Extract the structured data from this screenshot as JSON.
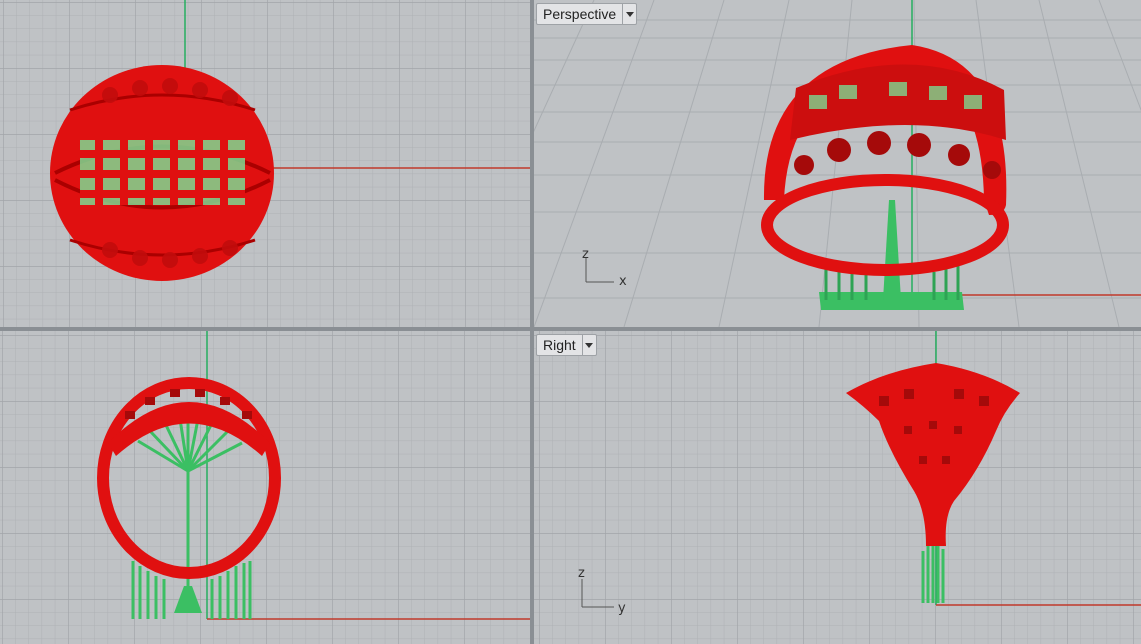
{
  "viewports": {
    "top": {
      "name": ""
    },
    "perspective": {
      "name": "Perspective",
      "axes": {
        "vertical": "z",
        "horizontal": "x"
      }
    },
    "front": {
      "name": ""
    },
    "right": {
      "name": "Right",
      "axes": {
        "vertical": "z",
        "horizontal": "y"
      }
    }
  },
  "colors": {
    "background": "#bfc2c5",
    "grid": "#a9adb1",
    "model": "#e01010",
    "supports": "#3bbf63",
    "x_axis": "#c0392b",
    "y_axis": "#27ae60"
  }
}
